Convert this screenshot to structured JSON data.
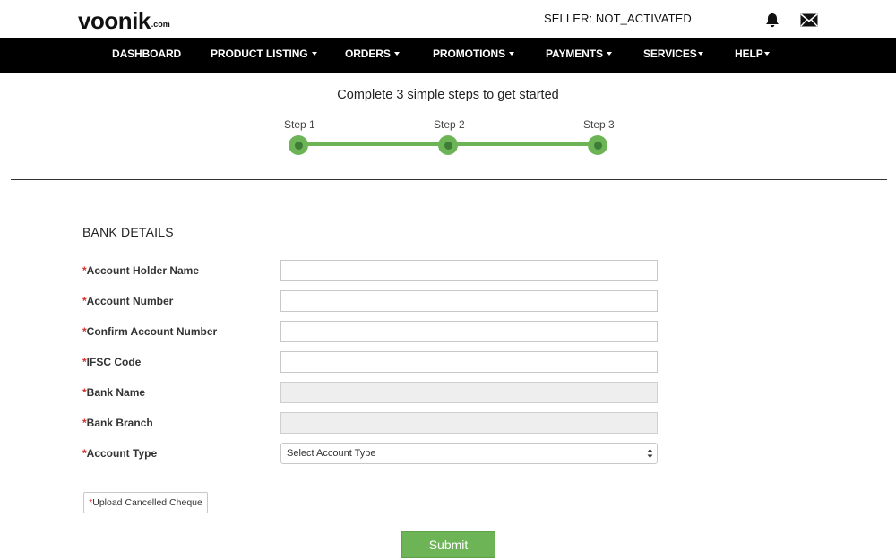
{
  "header": {
    "logo_main": "voonik",
    "logo_domain": ".com",
    "seller_status": "SELLER: NOT_ACTIVATED",
    "icons": [
      "bell-icon",
      "mail-icon"
    ]
  },
  "nav": {
    "items": [
      {
        "label": "DASHBOARD",
        "has_dropdown": false
      },
      {
        "label": "PRODUCT LISTING",
        "has_dropdown": true
      },
      {
        "label": "ORDERS",
        "has_dropdown": true
      },
      {
        "label": "PROMOTIONS",
        "has_dropdown": true
      },
      {
        "label": "PAYMENTS",
        "has_dropdown": true
      },
      {
        "label": "SERVICES",
        "has_dropdown": true
      },
      {
        "label": "HELP",
        "has_dropdown": true
      }
    ]
  },
  "steps": {
    "title": "Complete 3 simple steps to get started",
    "labels": [
      "Step 1",
      "Step 2",
      "Step 3"
    ],
    "accent_color": "#6db457"
  },
  "form": {
    "section_title": "BANK DETAILS",
    "required_mark": "*",
    "fields": [
      {
        "label": "Account Holder Name",
        "value": "",
        "disabled": false
      },
      {
        "label": "Account Number",
        "value": "",
        "disabled": false
      },
      {
        "label": "Confirm Account Number",
        "value": "",
        "disabled": false
      },
      {
        "label": "IFSC Code",
        "value": "",
        "disabled": false
      },
      {
        "label": "Bank Name",
        "value": "",
        "disabled": true
      },
      {
        "label": "Bank Branch",
        "value": "",
        "disabled": true
      }
    ],
    "account_type": {
      "label": "Account Type",
      "selected": "Select Account Type"
    },
    "upload_label": "Upload Cancelled Cheque",
    "submit_label": "Submit"
  }
}
